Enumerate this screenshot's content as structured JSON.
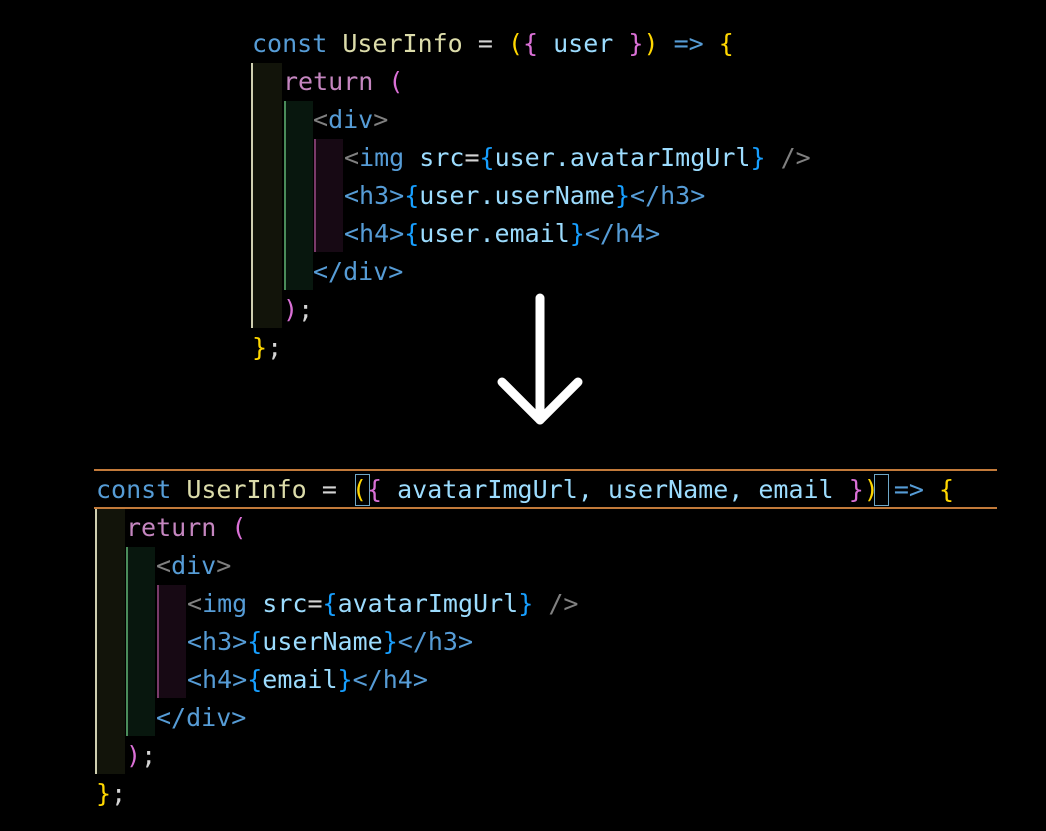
{
  "before": {
    "line1": {
      "kw": "const",
      "name": "UserInfo",
      "eq": "=",
      "p_open": "(",
      "b_open": "{",
      "param": "user",
      "b_close": "}",
      "p_close": ")",
      "arrow": "=>",
      "brace": "{"
    },
    "line2": {
      "kw": "return",
      "paren": "("
    },
    "line3": {
      "lt": "<",
      "tag": "div",
      "gt": ">"
    },
    "line4": {
      "lt": "<",
      "tag": "img",
      "attr": "src",
      "eq": "=",
      "ob": "{",
      "expr": "user.avatarImgUrl",
      "cb": "}",
      "end": "/>"
    },
    "line5": {
      "open": "<h3>",
      "ob": "{",
      "expr": "user.userName",
      "cb": "}",
      "close": "</h3>"
    },
    "line6": {
      "open": "<h4>",
      "ob": "{",
      "expr": "user.email",
      "cb": "}",
      "close": "</h4>"
    },
    "line7": {
      "close": "</div>"
    },
    "line8": {
      "paren": ")",
      "semi": ";"
    },
    "line9": {
      "brace": "}",
      "semi": ";"
    }
  },
  "after": {
    "line1": {
      "kw": "const",
      "name": "UserInfo",
      "eq": "=",
      "p_open": "(",
      "b_open": "{",
      "params": "avatarImgUrl, userName, email",
      "b_close": "}",
      "p_close": ")",
      "arrow": "=>",
      "brace": "{"
    },
    "line2": {
      "kw": "return",
      "paren": "("
    },
    "line3": {
      "lt": "<",
      "tag": "div",
      "gt": ">"
    },
    "line4": {
      "lt": "<",
      "tag": "img",
      "attr": "src",
      "eq": "=",
      "ob": "{",
      "expr": "avatarImgUrl",
      "cb": "}",
      "end": "/>"
    },
    "line5": {
      "open": "<h3>",
      "ob": "{",
      "expr": "userName",
      "cb": "}",
      "close": "</h3>"
    },
    "line6": {
      "open": "<h4>",
      "ob": "{",
      "expr": "email",
      "cb": "}",
      "close": "</h4>"
    },
    "line7": {
      "close": "</div>"
    },
    "line8": {
      "paren": ")",
      "semi": ";"
    },
    "line9": {
      "brace": "}",
      "semi": ";"
    }
  },
  "transition_icon": "down-arrow-icon",
  "colors": {
    "keyword": "#569cd6",
    "function_name": "#dcdcaa",
    "bracket_gold": "#ffd700",
    "bracket_orchid": "#da70d6",
    "bracket_blue": "#179fff",
    "return_keyword": "#c586c0",
    "variable": "#9cdcfe",
    "current_line_border": "#c27a3a"
  }
}
